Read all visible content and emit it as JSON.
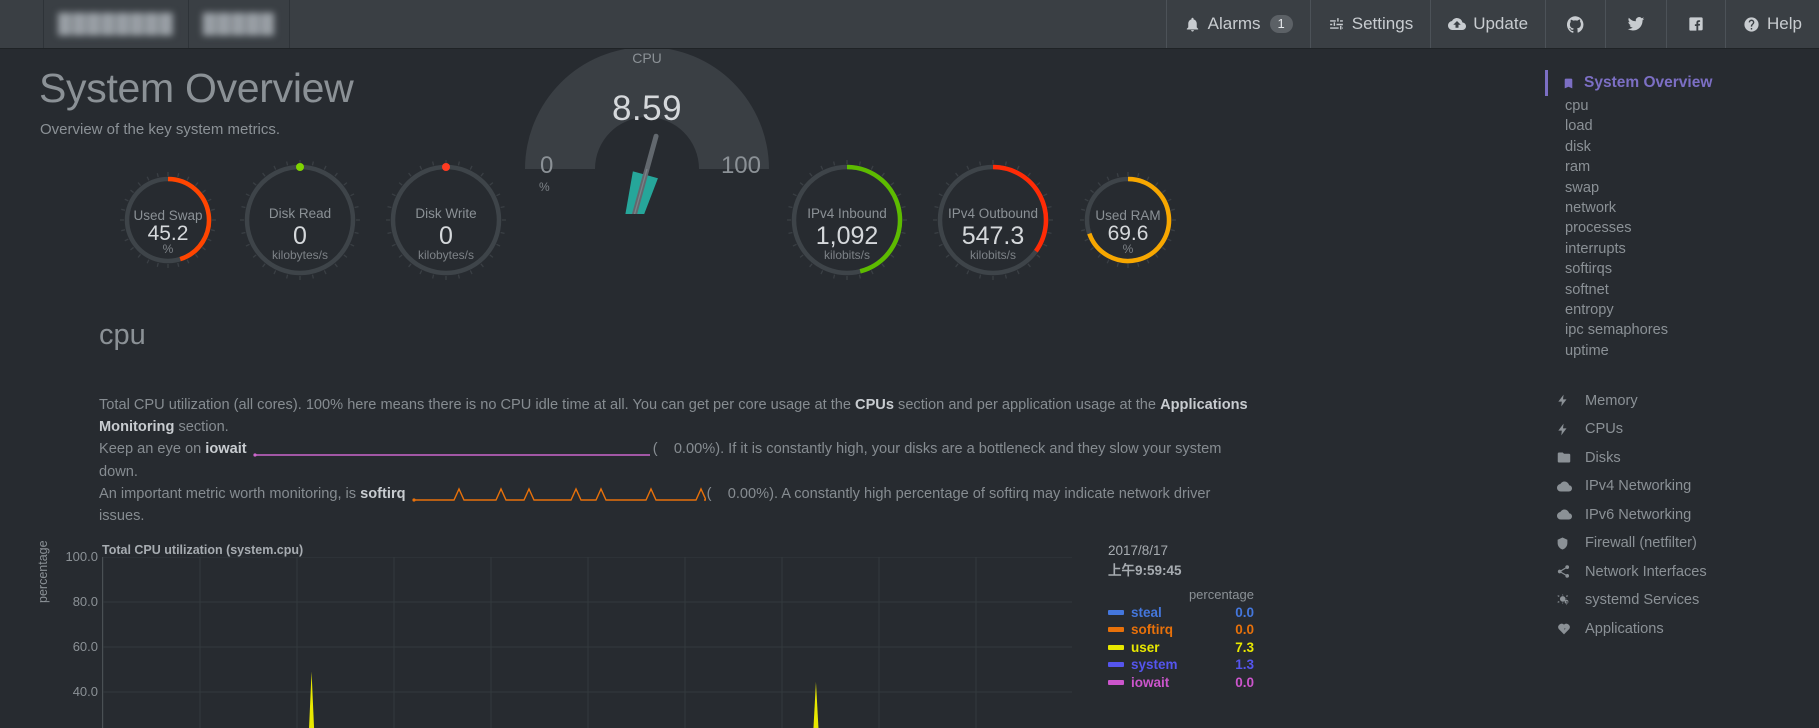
{
  "topnav": {
    "blurred_left": [
      "████████",
      "█████"
    ],
    "items": [
      {
        "label": "Alarms",
        "icon": "bell-icon",
        "badge": "1"
      },
      {
        "label": "Settings",
        "icon": "sliders-icon",
        "badge": ""
      },
      {
        "label": "Update",
        "icon": "cloud-download-icon",
        "badge": ""
      },
      {
        "label": "",
        "icon": "github-icon",
        "badge": ""
      },
      {
        "label": "",
        "icon": "twitter-icon",
        "badge": ""
      },
      {
        "label": "",
        "icon": "facebook-icon",
        "badge": ""
      },
      {
        "label": "Help",
        "icon": "question-circle-icon",
        "badge": ""
      }
    ]
  },
  "page": {
    "title": "System Overview",
    "subtitle": "Overview of the key system metrics."
  },
  "gauges": [
    {
      "name": "Used Swap",
      "value": "45.2",
      "unit": "%",
      "color": "#ff4500",
      "pct": 45.2,
      "dot": ""
    },
    {
      "name": "Disk Read",
      "value": "0",
      "unit": "kilobytes/s",
      "color": "#888888",
      "pct": 0,
      "dot": "#7fd400"
    },
    {
      "name": "Disk Write",
      "value": "0",
      "unit": "kilobytes/s",
      "color": "#888888",
      "pct": 0,
      "dot": "#ff3b21"
    },
    {
      "name": "IPv4 Inbound",
      "value": "1,092",
      "unit": "kilobits/s",
      "color": "#5dbb00",
      "pct": 46,
      "dot": ""
    },
    {
      "name": "IPv4 Outbound",
      "value": "547.3",
      "unit": "kilobits/s",
      "color": "#ff2b06",
      "pct": 35,
      "dot": ""
    },
    {
      "name": "Used RAM",
      "value": "69.6",
      "unit": "%",
      "color": "#f7a700",
      "pct": 69.6,
      "dot": ""
    }
  ],
  "cpu_gauge": {
    "name": "CPU",
    "value": "8.59",
    "min": "0",
    "max": "100",
    "unit": "%",
    "color": "#26a69a"
  },
  "cpu_section": {
    "heading": "cpu",
    "p1_a": "Total CPU utilization (all cores). 100% here means there is no CPU idle time at all. You can get per core usage at the ",
    "p1_link1": "CPUs",
    "p1_b": " section and per application usage at the ",
    "p1_link2": "Applications Monitoring",
    "p1_c": " section.",
    "p2_a": "Keep an eye on ",
    "p2_metric": "iowait",
    "p2_open": "(",
    "p2_value": "0.00%",
    "p2_b": "). If it is constantly high, your disks are a bottleneck and they slow your system down.",
    "p3_a": "An important metric worth monitoring, is ",
    "p3_metric": "softirq",
    "p3_open": "(",
    "p3_value": "0.00%",
    "p3_b": "). A constantly high percentage of softirq may indicate network driver",
    "p4": "issues.",
    "iowait_color": "#cc66cc",
    "softirq_color": "#e8710a"
  },
  "chart_data": {
    "type": "area",
    "title": "Total CPU utilization (system.cpu)",
    "ylabel": "percentage",
    "xlabel": "",
    "ylim": [
      0,
      100
    ],
    "yticks": [
      "100.0",
      "80.0",
      "60.0",
      "40.0"
    ],
    "grid": true,
    "hover": {
      "date": "2017/8/17",
      "time": "上午9:59:45",
      "unit_header": "percentage"
    },
    "legend_position": "right",
    "series": [
      {
        "name": "steal",
        "value": "0.0",
        "color": "#4477dd"
      },
      {
        "name": "softirq",
        "value": "0.0",
        "color": "#e8710a"
      },
      {
        "name": "user",
        "value": "7.3",
        "color": "#e8e800"
      },
      {
        "name": "system",
        "value": "1.3",
        "color": "#5555ee"
      },
      {
        "name": "iowait",
        "value": "0.0",
        "color": "#cc55cc"
      }
    ],
    "spikes": [
      {
        "x": 0.215,
        "h": 0.33,
        "series": "user"
      },
      {
        "x": 0.735,
        "h": 0.27,
        "series": "user"
      }
    ]
  },
  "sidebar": {
    "active": {
      "label": "System Overview",
      "icon": "bookmark-icon"
    },
    "sub_items": [
      "cpu",
      "load",
      "disk",
      "ram",
      "swap",
      "network",
      "processes",
      "interrupts",
      "softirqs",
      "softnet",
      "entropy",
      "ipc semaphores",
      "uptime"
    ],
    "sections": [
      {
        "label": "Memory",
        "icon": "bolt-icon"
      },
      {
        "label": "CPUs",
        "icon": "bolt-icon"
      },
      {
        "label": "Disks",
        "icon": "folder-icon"
      },
      {
        "label": "IPv4 Networking",
        "icon": "cloud-icon"
      },
      {
        "label": "IPv6 Networking",
        "icon": "cloud-icon"
      },
      {
        "label": "Firewall (netfilter)",
        "icon": "shield-icon"
      },
      {
        "label": "Network Interfaces",
        "icon": "share-icon"
      },
      {
        "label": "systemd Services",
        "icon": "gears-icon"
      },
      {
        "label": "Applications",
        "icon": "heartbeat-icon"
      }
    ],
    "accent": "#7c6fc4"
  }
}
